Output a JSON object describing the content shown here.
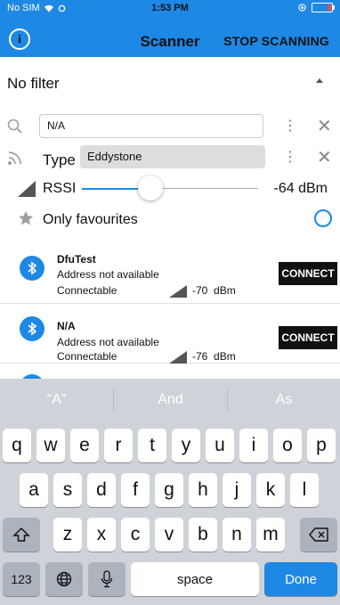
{
  "status": {
    "carrier": "No SIM",
    "time": "1:53 PM"
  },
  "nav": {
    "title": "Scanner",
    "stop_label": "STOP SCANNING",
    "info_glyph": "i"
  },
  "filter": {
    "header": "No filter",
    "name_value": "N/A",
    "type_label": "Type",
    "type_value": "Eddystone",
    "rssi_label": "RSSI",
    "rssi_value": "-64 dBm",
    "rssi_slider_fraction": 0.22,
    "favourites_label": "Only favourites",
    "favourites_checked": false
  },
  "devices": [
    {
      "name": "DfuTest",
      "address": "Address not available",
      "connectable": "Connectable",
      "rssi": "-70",
      "unit": "dBm",
      "connect_label": "CONNECT"
    },
    {
      "name": "N/A",
      "address": "Address not available",
      "connectable": "Connectable",
      "rssi": "-76",
      "unit": "dBm",
      "connect_label": "CONNECT"
    }
  ],
  "keyboard": {
    "suggestions": [
      "“A”",
      "And",
      "As"
    ],
    "row1": [
      "q",
      "w",
      "e",
      "r",
      "t",
      "y",
      "u",
      "i",
      "o",
      "p"
    ],
    "row2": [
      "a",
      "s",
      "d",
      "f",
      "g",
      "h",
      "j",
      "k",
      "l"
    ],
    "row3": [
      "z",
      "x",
      "c",
      "v",
      "b",
      "n",
      "m"
    ],
    "numbers_label": "123",
    "space_label": "space",
    "done_label": "Done"
  },
  "colors": {
    "accent": "#1e88e5"
  }
}
